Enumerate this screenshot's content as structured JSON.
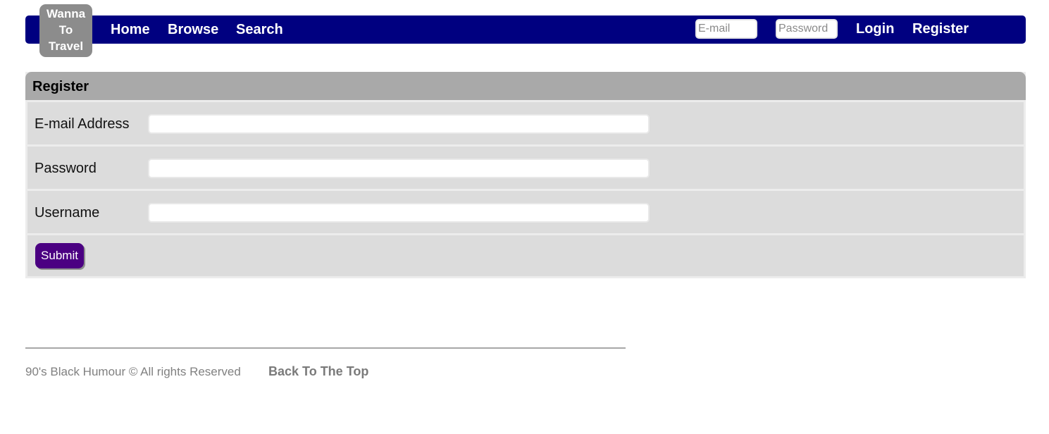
{
  "nav": {
    "logo_lines": [
      "Wanna",
      "To",
      "Travel"
    ],
    "links": [
      "Home",
      "Browse",
      "Search"
    ],
    "email_placeholder": "E-mail",
    "password_placeholder": "Password",
    "login_label": "Login",
    "register_label": "Register",
    "bar_color": "#000080"
  },
  "form": {
    "title": "Register",
    "fields": [
      {
        "label": "E-mail Address",
        "value": ""
      },
      {
        "label": "Password",
        "value": ""
      },
      {
        "label": "Username",
        "value": ""
      }
    ],
    "submit_label": "Submit",
    "submit_color": "#4b0082"
  },
  "footer": {
    "copyright": "90's Black Humour © All rights Reserved",
    "back_to_top": "Back To The Top"
  }
}
